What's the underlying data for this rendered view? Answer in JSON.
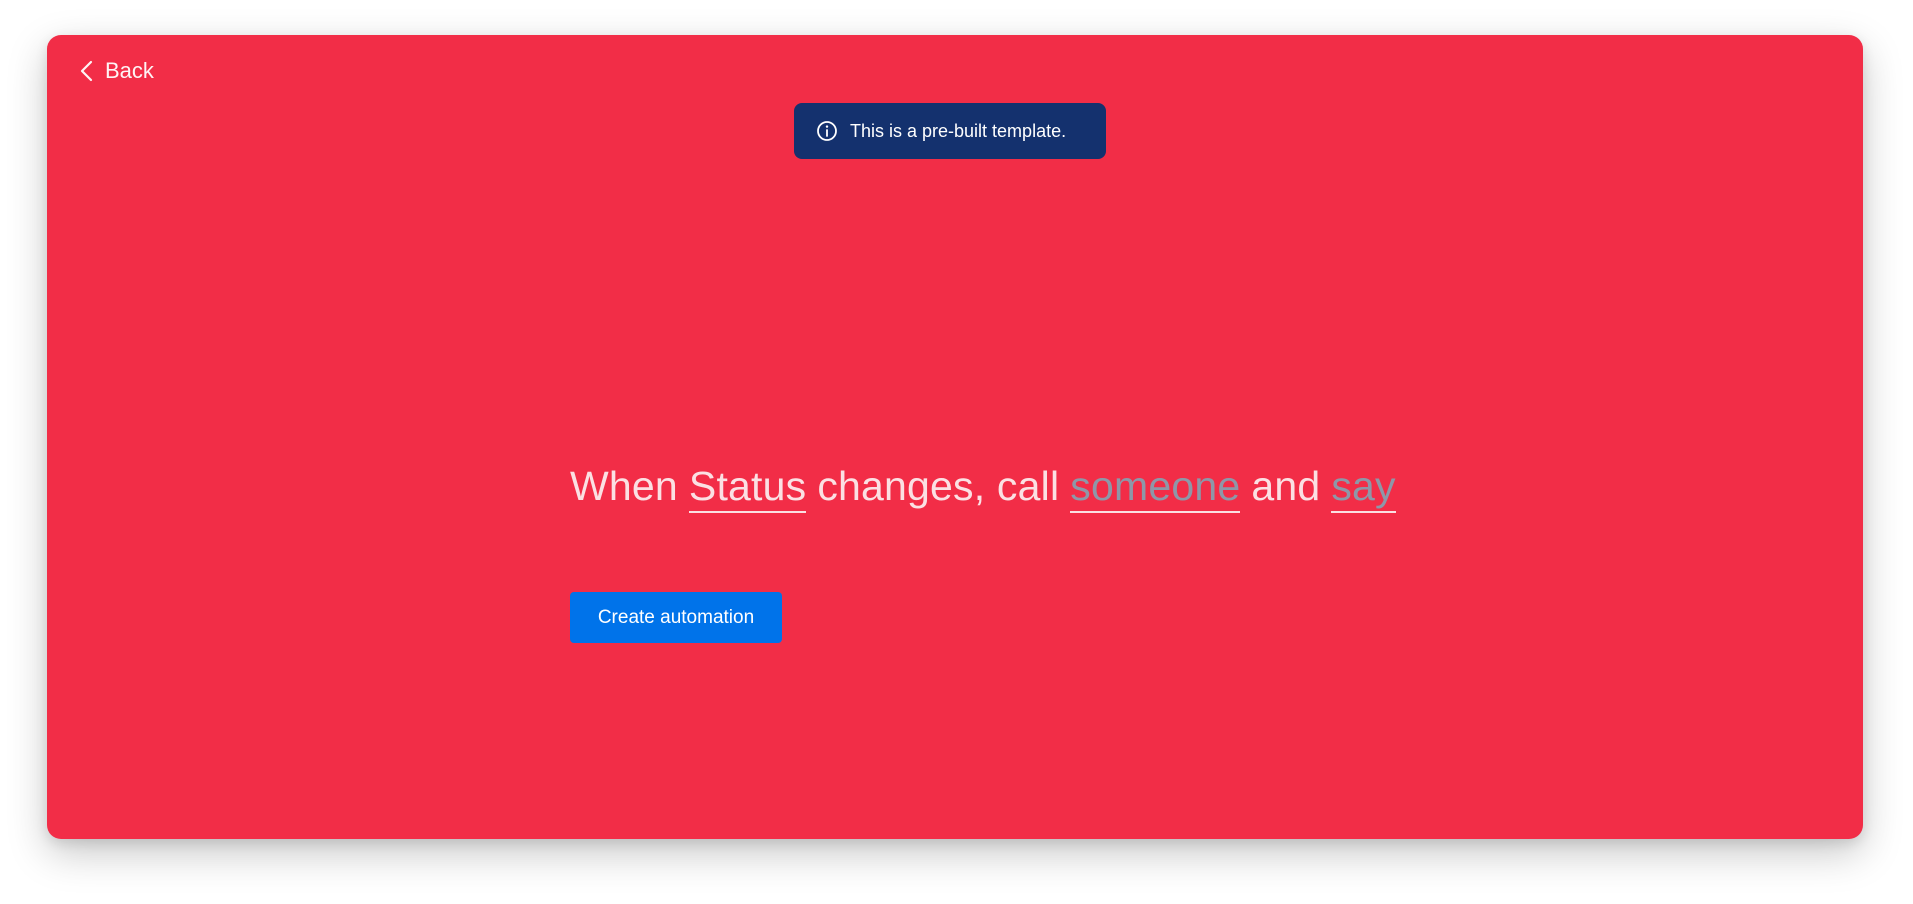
{
  "header": {
    "back_label": "Back"
  },
  "banner": {
    "text": "This is a pre-built template."
  },
  "sentence": {
    "when": "When",
    "trigger_field": "Status",
    "changes_call": "changes, call",
    "recipient_field": "someone",
    "and": "and",
    "message_field": "say"
  },
  "actions": {
    "create_label": "Create automation"
  },
  "icons": {
    "back": "chevron-left-icon",
    "info": "info-icon"
  },
  "colors": {
    "modal_bg": "#f22d47",
    "banner_bg": "#14316e",
    "primary_button": "#0073ea",
    "placeholder_text": "#8e97a8"
  }
}
